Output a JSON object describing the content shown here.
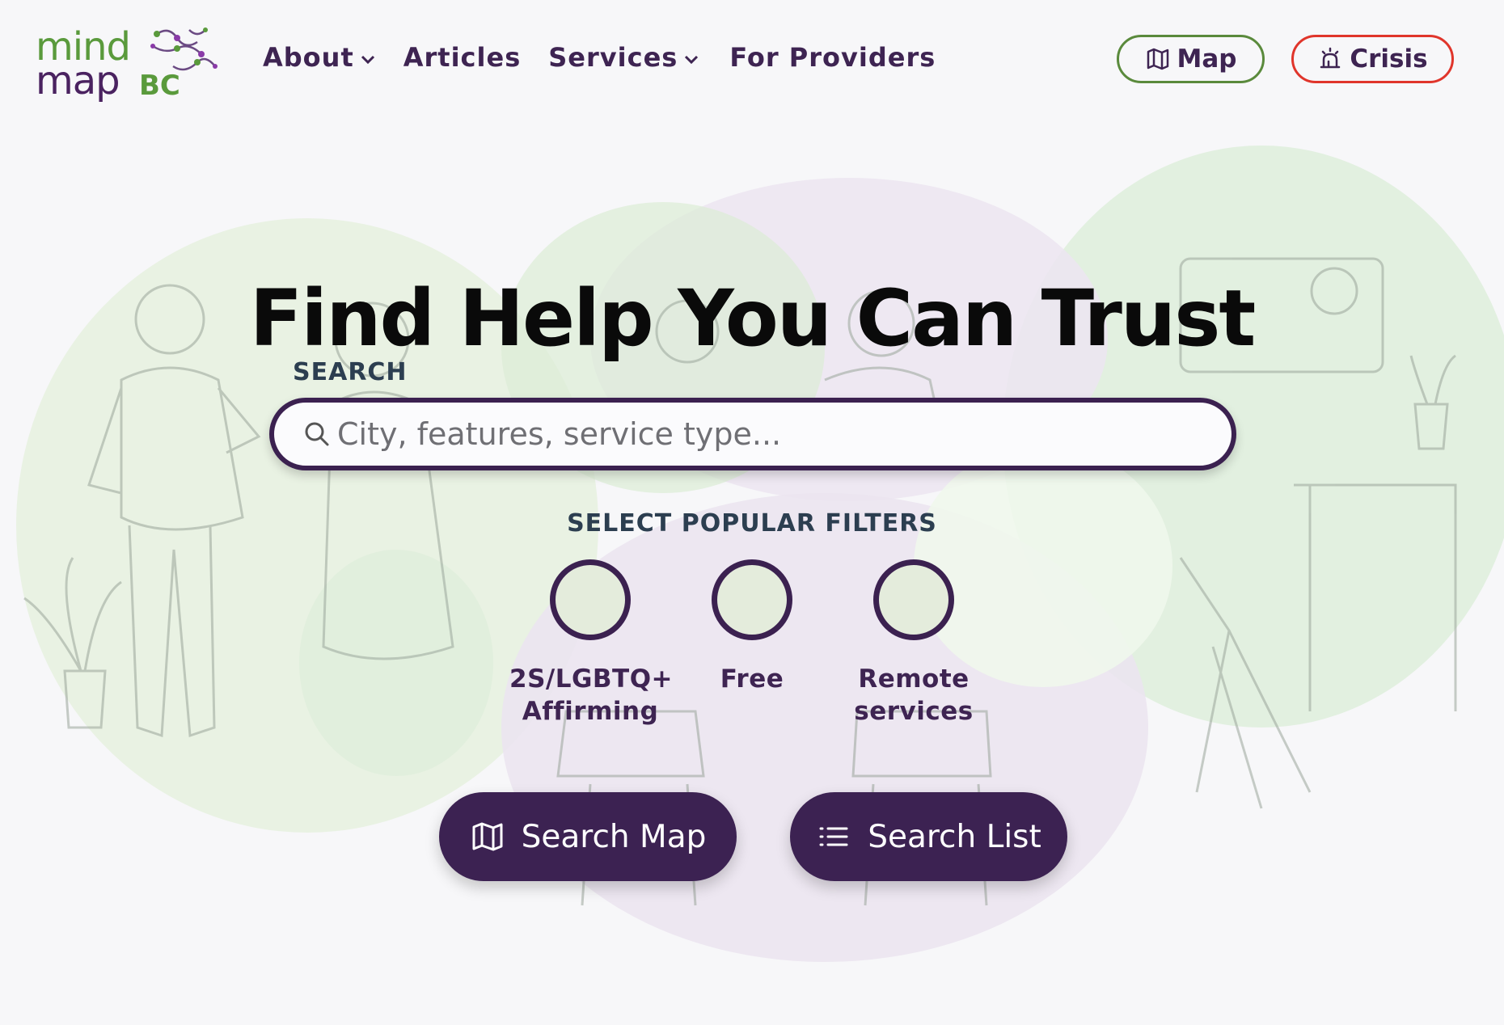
{
  "brand": {
    "logo_mind": "mind",
    "logo_map": "map",
    "logo_bc": "BC"
  },
  "nav": {
    "about": "About",
    "articles": "Articles",
    "services": "Services",
    "for_providers": "For Providers"
  },
  "header_buttons": {
    "map": "Map",
    "crisis": "Crisis"
  },
  "hero": {
    "title": "Find Help You Can Trust",
    "search_label": "SEARCH",
    "search_placeholder": "City, features, service type...",
    "filters_label": "SELECT POPULAR FILTERS",
    "filters": [
      {
        "line1": "2S/LGBTQ+",
        "line2": "Affirming"
      },
      {
        "line1": "Free",
        "line2": ""
      },
      {
        "line1": "Remote",
        "line2": "services"
      }
    ],
    "search_map_label": "Search Map",
    "search_list_label": "Search List"
  },
  "colors": {
    "brand_purple": "#3c2252",
    "brand_green": "#5a9a3c",
    "crisis_red": "#e0352b",
    "filter_fill": "#e4ecdc"
  },
  "icons": [
    "map-icon",
    "alarm-icon",
    "search-icon",
    "list-icon",
    "chevron-down-icon"
  ]
}
